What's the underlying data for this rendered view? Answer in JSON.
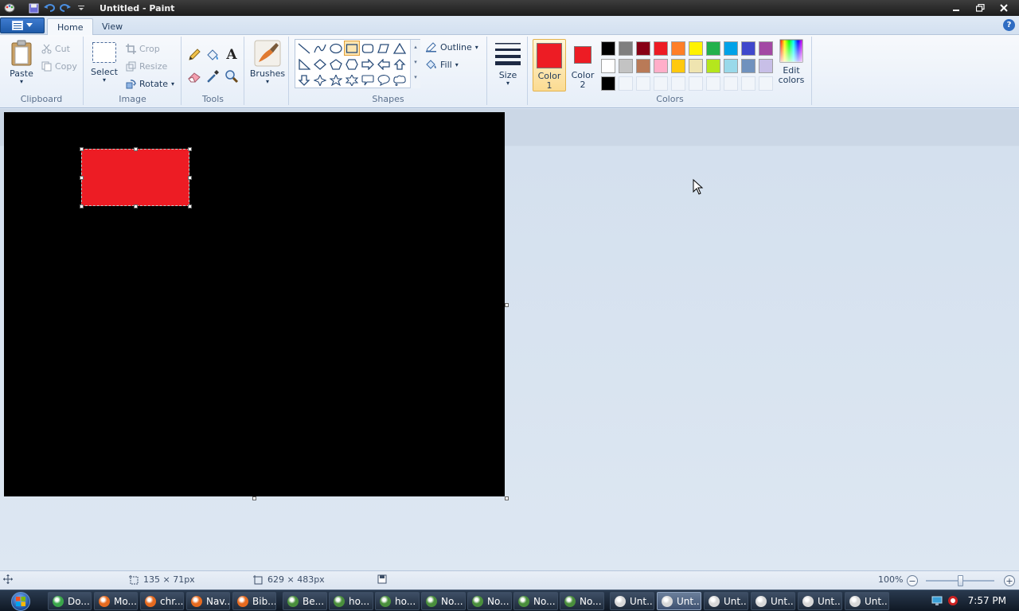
{
  "window": {
    "title": "Untitled - Paint"
  },
  "tabs": [
    {
      "label": "Home"
    },
    {
      "label": "View"
    }
  ],
  "help_label": "?",
  "clipboard": {
    "group_label": "Clipboard",
    "paste": "Paste",
    "cut": "Cut",
    "copy": "Copy"
  },
  "image": {
    "group_label": "Image",
    "select": "Select",
    "crop": "Crop",
    "resize": "Resize",
    "rotate": "Rotate"
  },
  "tools": {
    "group_label": "Tools",
    "text_tool_glyph": "A"
  },
  "brushes": {
    "label": "Brushes"
  },
  "shapes": {
    "group_label": "Shapes",
    "outline": "Outline",
    "fill": "Fill"
  },
  "size": {
    "label": "Size"
  },
  "colors": {
    "group_label": "Colors",
    "color1_label": "Color",
    "color1_num": "1",
    "color2_label": "Color",
    "color2_num": "2",
    "edit_label": "Edit",
    "edit_label2": "colors",
    "color1_value": "#ed1c24",
    "color2_value": "#ed1c24",
    "palette_row1": [
      "#000000",
      "#7f7f7f",
      "#880015",
      "#ed1c24",
      "#ff7f27",
      "#fff200",
      "#22b14c",
      "#00a2e8",
      "#3f48cc",
      "#a349a4"
    ],
    "palette_row2": [
      "#ffffff",
      "#c3c3c3",
      "#b97a57",
      "#ffaec9",
      "#ffc90e",
      "#efe4b0",
      "#b5e61d",
      "#99d9ea",
      "#7092be",
      "#c8bfe7"
    ],
    "palette_row3": [
      "#000000"
    ]
  },
  "canvas": {
    "background": "#000000",
    "shape_fill": "#ed1c24"
  },
  "status": {
    "selection_size": "135 × 71px",
    "canvas_size": "629 × 483px",
    "zoom": "100%",
    "zoom_level": 0.5
  },
  "taskbar": {
    "items": [
      {
        "label": "Do...",
        "icon": "download-icon",
        "color": "#3aa64a"
      },
      {
        "label": "Mo...",
        "icon": "firefox-icon",
        "color": "#e66a1f"
      },
      {
        "label": "chr...",
        "icon": "firefox-icon",
        "color": "#e66a1f"
      },
      {
        "label": "Nav...",
        "icon": "firefox-icon",
        "color": "#e66a1f"
      },
      {
        "label": "Bib...",
        "icon": "firefox-icon",
        "color": "#e66a1f"
      },
      {
        "label": "Be...",
        "icon": "chrome-icon",
        "color": "#4a8f3c"
      },
      {
        "label": "ho...",
        "icon": "chrome-icon",
        "color": "#4a8f3c"
      },
      {
        "label": "ho...",
        "icon": "chrome-icon",
        "color": "#4a8f3c"
      },
      {
        "label": "No...",
        "icon": "chrome-icon",
        "color": "#4a8f3c"
      },
      {
        "label": "No...",
        "icon": "chrome-icon",
        "color": "#4a8f3c"
      },
      {
        "label": "No...",
        "icon": "chrome-icon",
        "color": "#4a8f3c"
      },
      {
        "label": "No...",
        "icon": "chrome-icon",
        "color": "#4a8f3c"
      },
      {
        "label": "Unt...",
        "icon": "paint-icon",
        "color": "#d8d8d8"
      },
      {
        "label": "Unt...",
        "icon": "paint-icon",
        "color": "#d8d8d8"
      },
      {
        "label": "Unt...",
        "icon": "paint-icon",
        "color": "#d8d8d8"
      },
      {
        "label": "Unt...",
        "icon": "paint-icon",
        "color": "#d8d8d8"
      },
      {
        "label": "Unt...",
        "icon": "paint-icon",
        "color": "#d8d8d8"
      },
      {
        "label": "Unt...",
        "icon": "paint-icon",
        "color": "#d8d8d8"
      }
    ],
    "clock": "7:57 PM"
  }
}
